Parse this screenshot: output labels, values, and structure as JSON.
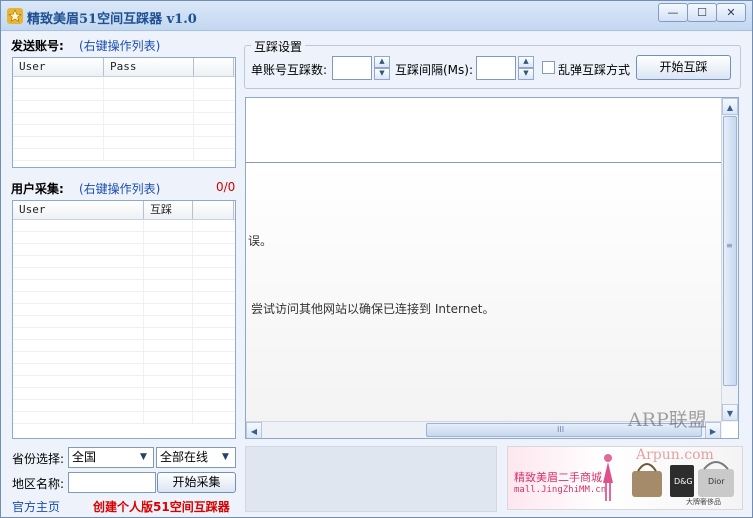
{
  "window": {
    "title": "精致美眉51空间互踩器 v1.0",
    "minimize": "—",
    "maximize": "☐",
    "close": "✕"
  },
  "send_accounts": {
    "label": "发送账号:",
    "hint": "(右键操作列表)",
    "columns": [
      "User",
      "Pass"
    ]
  },
  "user_collect": {
    "label": "用户采集:",
    "hint": "(右键操作列表)",
    "count": "0/0",
    "columns": [
      "User",
      "互踩"
    ]
  },
  "settings": {
    "group_title": "互踩设置",
    "per_account_label": "单账号互踩数:",
    "interval_label": "互踩间隔(Ms):",
    "random_label": "乱弹互踩方式",
    "random_checked": false,
    "start_button": "开始互踩"
  },
  "browser": {
    "error_fragment": "误。",
    "hint_text": "尝试访问其他网站以确保已连接到 Internet。",
    "hscroll_grip": "III",
    "vscroll_grip": "≡"
  },
  "filters": {
    "province_label": "省份选择:",
    "province_value": "全国",
    "status_value": "全部在线",
    "region_label": "地区名称:",
    "region_value": "",
    "collect_button": "开始采集"
  },
  "footer": {
    "home_link": "官方主页",
    "promo_link": "创建个人版51空间互踩器"
  },
  "ad": {
    "line1": "精致美眉二手商城",
    "line2": "mall.JingZhiMM.cn",
    "bag_label_a": "D&G",
    "bag_label_b": "Dior",
    "bag_caption": "大牌奢侈品"
  },
  "watermark": {
    "line1": "ARP联盟",
    "line2": "Arpun.com"
  },
  "colors": {
    "accent_blue": "#1a4cb5",
    "count_red": "#d80000",
    "title_blue": "#1d4f91"
  }
}
